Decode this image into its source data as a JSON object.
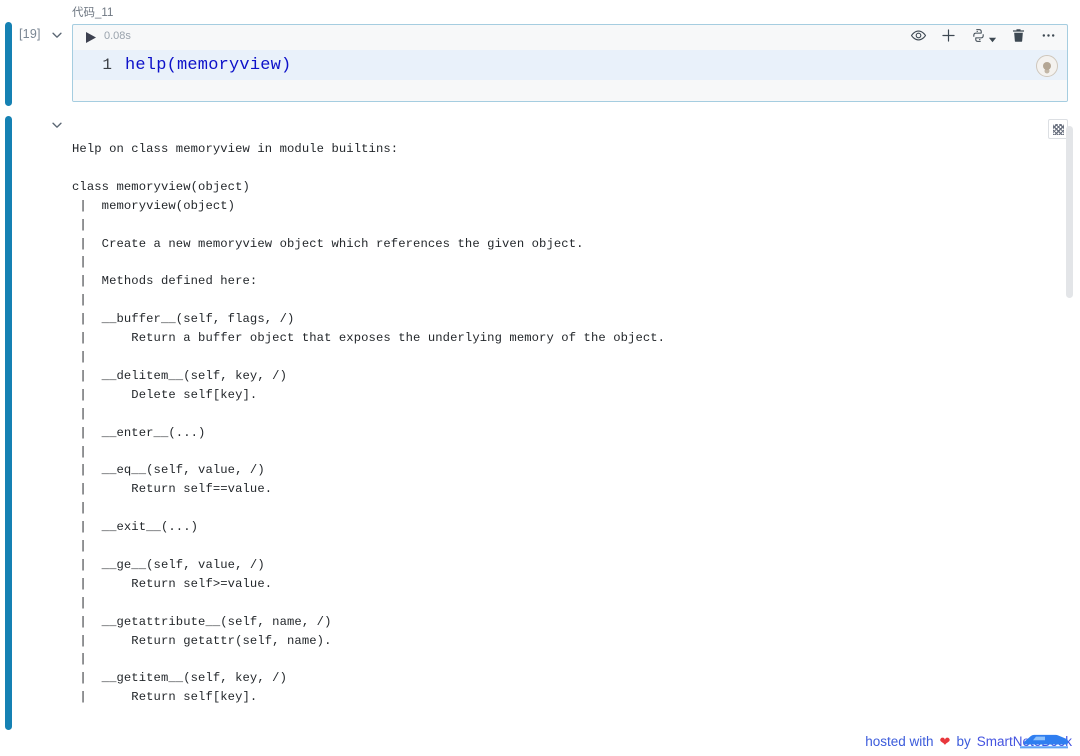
{
  "cell": {
    "title": "代码_11",
    "execution_count": "[19]",
    "execution_time": "0.08s",
    "line_number": "1",
    "code": "help(memoryview)",
    "accent_color": "#1581b3",
    "code_color": "#0d11c9",
    "cell_border_color": "#a5cde0",
    "code_bg_color": "#e9f1fa"
  },
  "toolbar": {
    "icons": [
      {
        "name": "eye-icon",
        "label": "Toggle visibility"
      },
      {
        "name": "plus-icon",
        "label": "Add cell"
      },
      {
        "name": "kernel-icon",
        "label": "Kernel"
      },
      {
        "name": "chevron-down-icon",
        "label": "Kernel menu"
      },
      {
        "name": "trash-icon",
        "label": "Delete cell"
      },
      {
        "name": "ellipsis-icon",
        "label": "More options"
      }
    ],
    "run_label": "Run cell",
    "avatar_label": "Assistant"
  },
  "output": {
    "toolbutton_label": "Output settings",
    "text": "Help on class memoryview in module builtins:\n\nclass memoryview(object)\n |  memoryview(object)\n |\n |  Create a new memoryview object which references the given object.\n |\n |  Methods defined here:\n |\n |  __buffer__(self, flags, /)\n |      Return a buffer object that exposes the underlying memory of the object.\n |\n |  __delitem__(self, key, /)\n |      Delete self[key].\n |\n |  __enter__(...)\n |\n |  __eq__(self, value, /)\n |      Return self==value.\n |\n |  __exit__(...)\n |\n |  __ge__(self, value, /)\n |      Return self>=value.\n |\n |  __getattribute__(self, name, /)\n |      Return getattr(self, name).\n |\n |  __getitem__(self, key, /)\n |      Return self[key]."
  },
  "footer": {
    "prefix": "hosted with",
    "heart": "❤",
    "middle": "by",
    "brand": "SmartNoteBook",
    "link_color": "#3b5bdb"
  }
}
